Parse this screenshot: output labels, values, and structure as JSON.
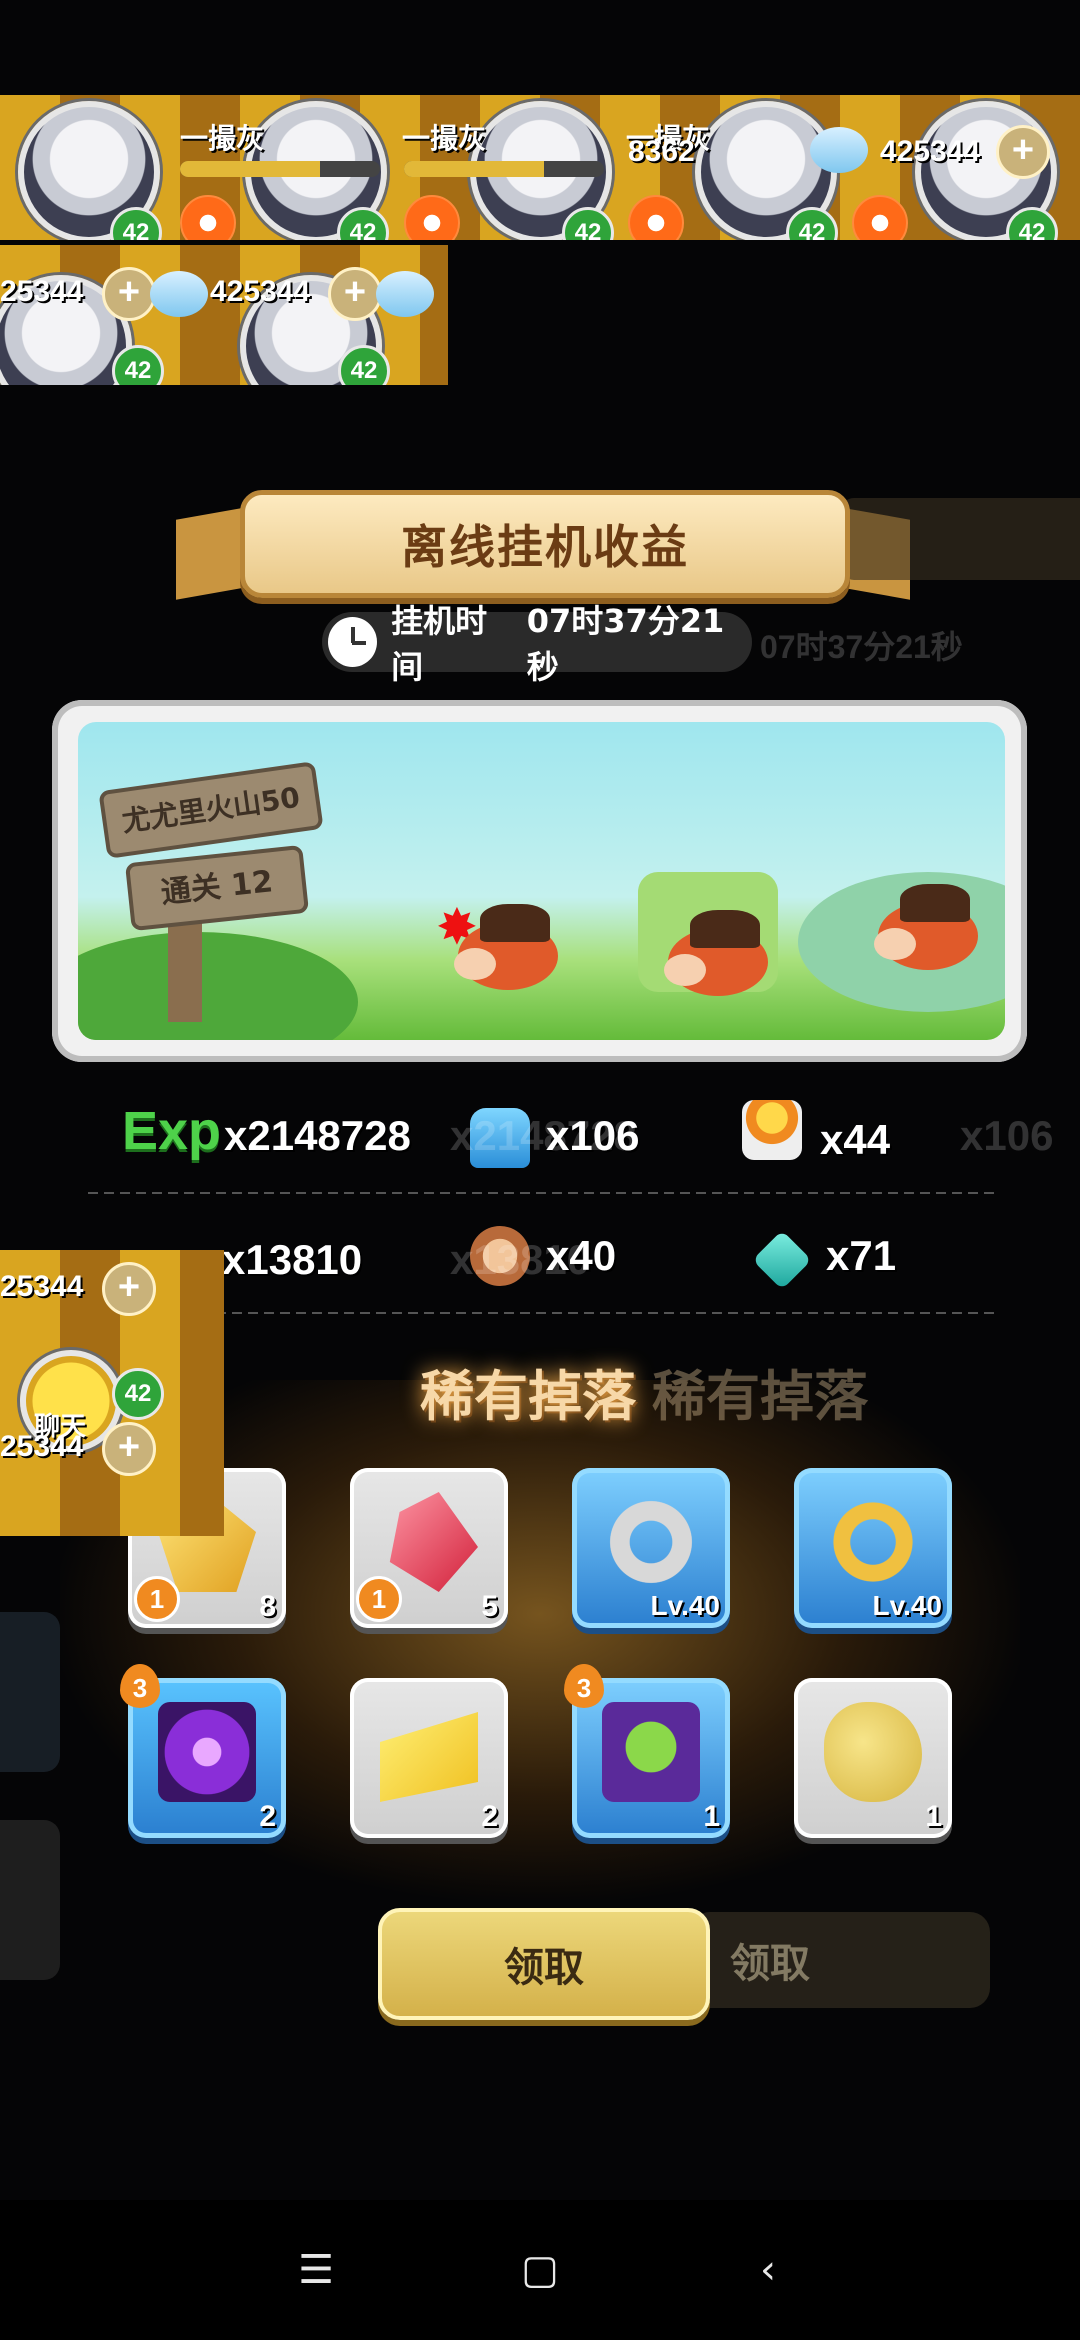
{
  "hud": {
    "player_name": "一撮灰",
    "level": "42",
    "coins": "8362",
    "gems": "425344",
    "gems_short": "25344",
    "plus": "+",
    "chat_label": "聊天"
  },
  "offline": {
    "title": "离线挂机收益",
    "timer_label": "挂机时间",
    "timer_value": "07时37分21秒",
    "stage_name": "尤尤里火山50",
    "stage_progress": "通关 12"
  },
  "rewards": {
    "exp_label": "Exp",
    "exp_value": "x2148728",
    "shirt_value": "x106",
    "torch_value": "x44",
    "stone_value": "x13810",
    "meat_value": "x40",
    "crystal_value": "x71"
  },
  "rare_drop": {
    "title": "稀有掉落",
    "items": [
      {
        "icon": "gold-ore-icon",
        "count": "8",
        "badge": "1",
        "style": "gray"
      },
      {
        "icon": "red-crystal-icon",
        "count": "5",
        "badge": "1",
        "style": "gray"
      },
      {
        "icon": "silver-ring-icon",
        "level": "Lv.40",
        "style": "blue"
      },
      {
        "icon": "gold-bracelet-icon",
        "level": "Lv.40",
        "style": "blue"
      },
      {
        "icon": "dark-bow-icon",
        "count": "2",
        "star": "3",
        "style": "blue"
      },
      {
        "icon": "cheese-icon",
        "count": "2",
        "style": "gray"
      },
      {
        "icon": "frog-pet-icon",
        "count": "1",
        "star": "3",
        "style": "blue"
      },
      {
        "icon": "potato-icon",
        "count": "1",
        "style": "gray"
      }
    ]
  },
  "actions": {
    "claim_label": "领取"
  },
  "colors": {
    "exp_green": "#4ed24a",
    "banner_brown": "#6b3c14",
    "claim_gold": "#d4b14a",
    "card_blue": "#2a7ecf"
  }
}
